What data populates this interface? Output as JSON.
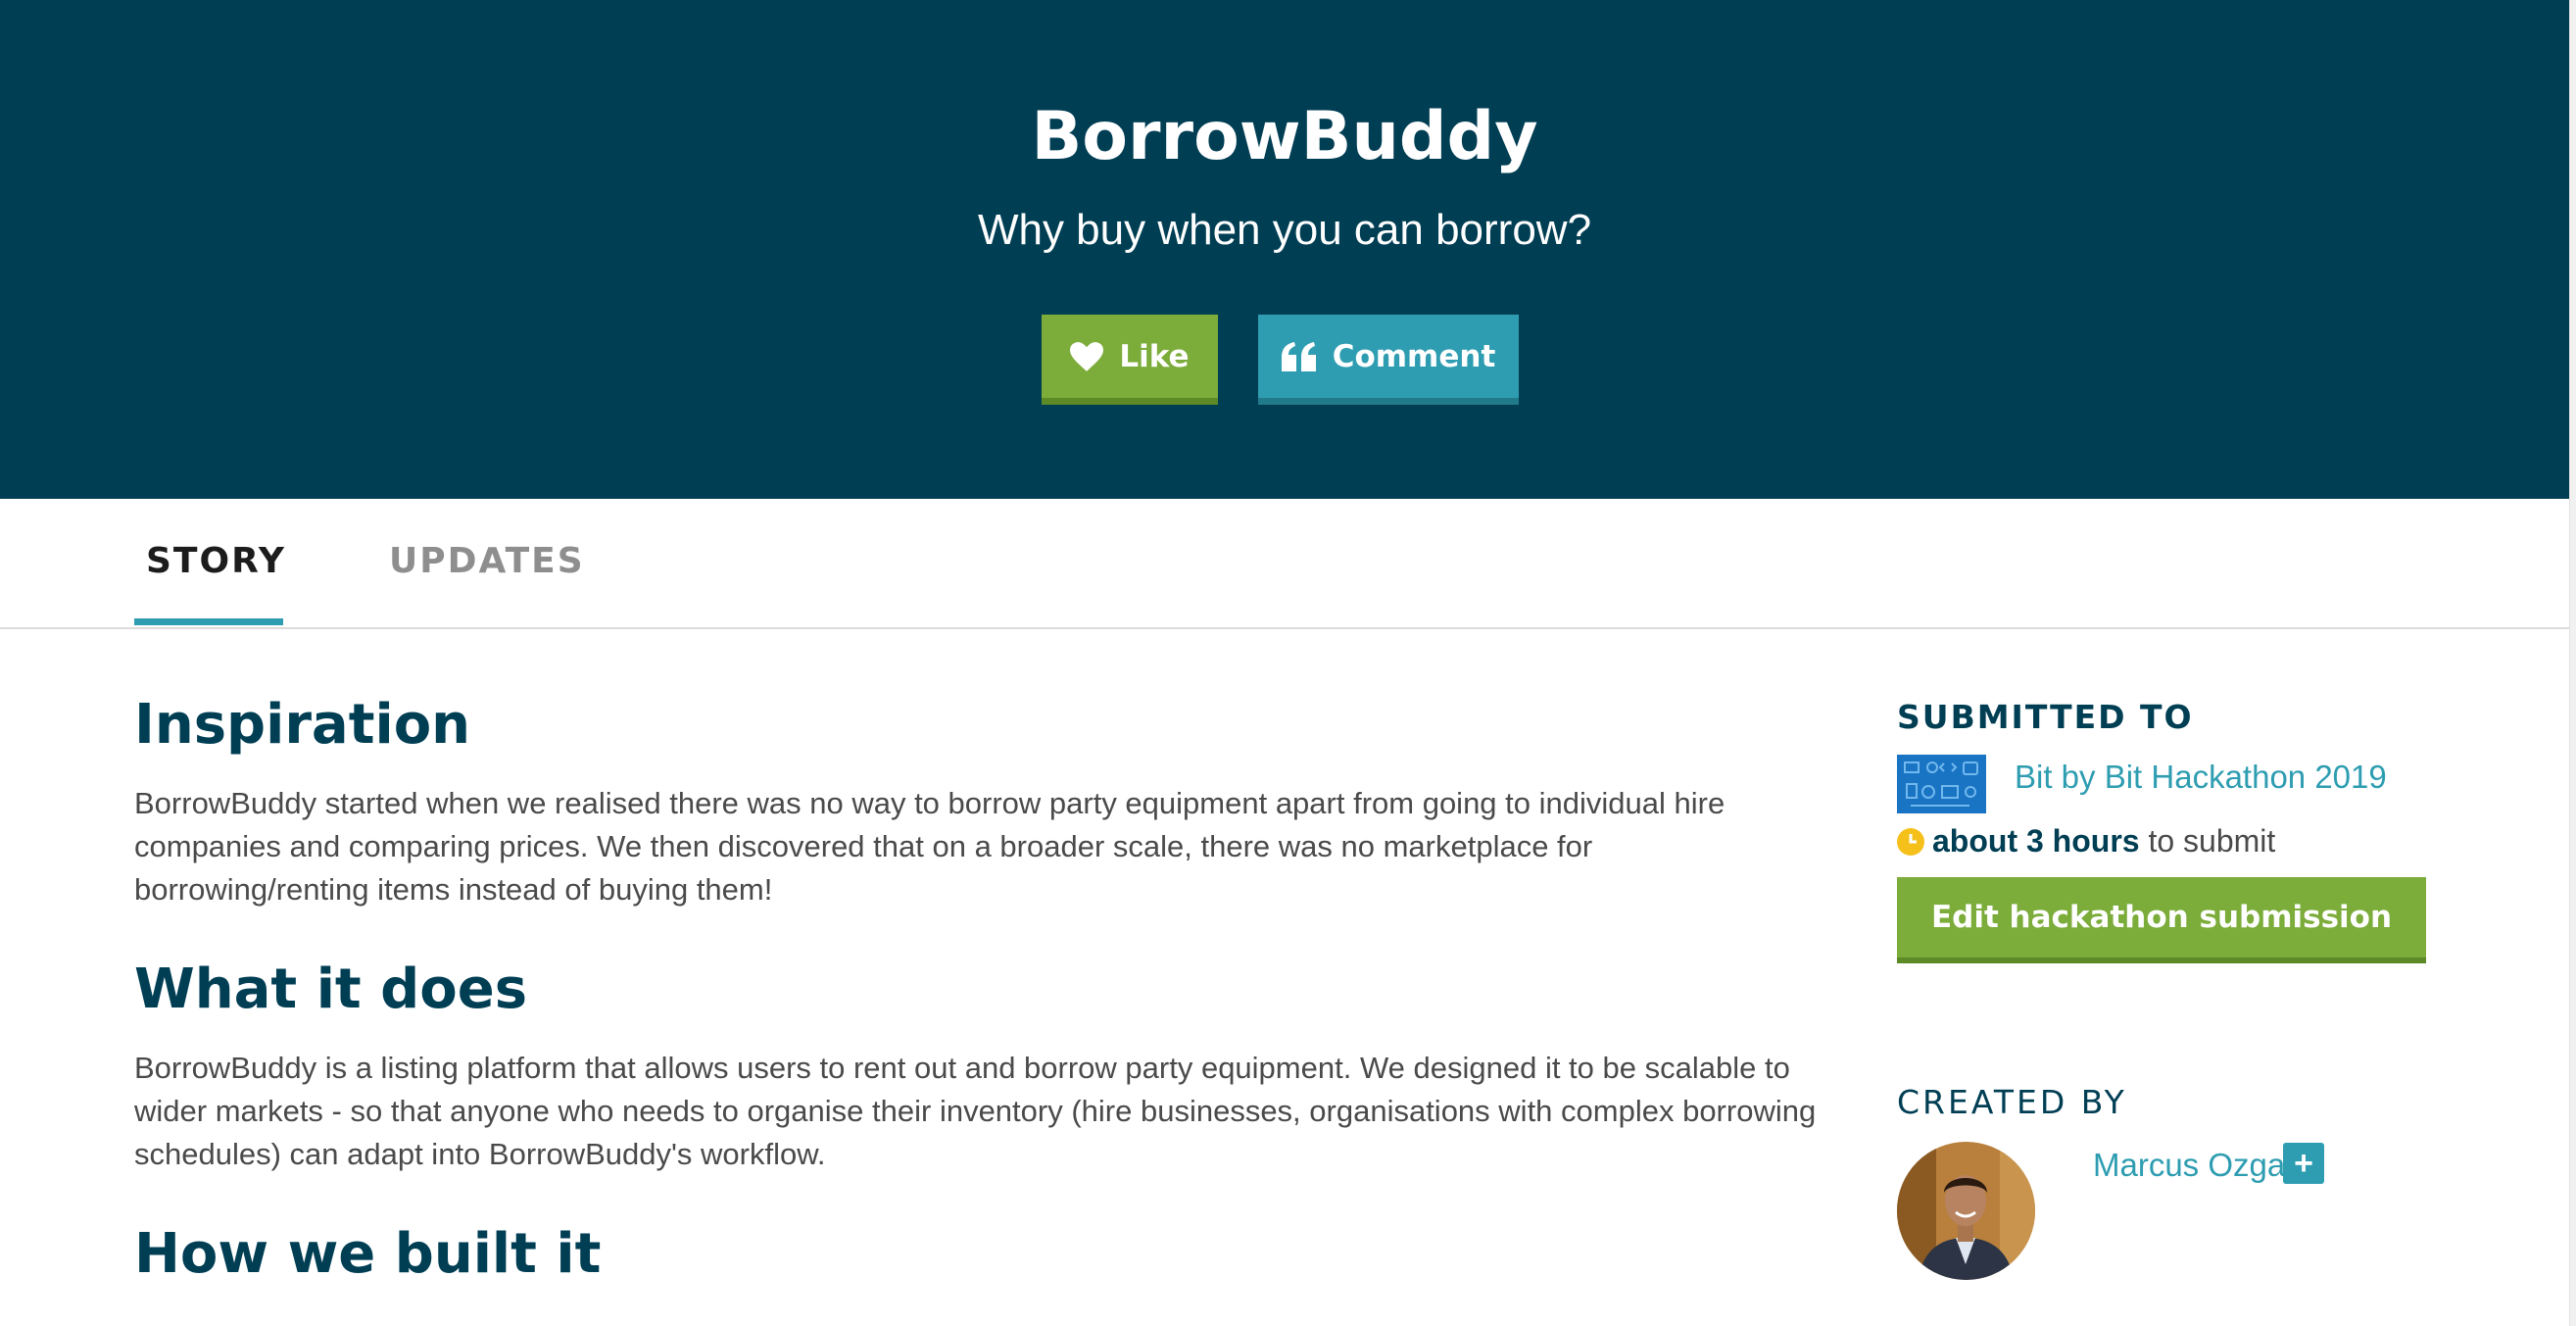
{
  "header": {
    "title": "BorrowBuddy",
    "tagline": "Why buy when you can borrow?",
    "like_label": "Like",
    "comment_label": "Comment"
  },
  "tabs": [
    {
      "label": "STORY",
      "active": true
    },
    {
      "label": "UPDATES",
      "active": false
    }
  ],
  "story": [
    {
      "heading": "Inspiration",
      "text": "BorrowBuddy started when we realised there was no way to borrow party equipment apart from going to individual hire companies and comparing prices. We then discovered that on a broader scale, there was no marketplace for borrowing/renting items instead of buying them!"
    },
    {
      "heading": "What it does",
      "text": "BorrowBuddy is a listing platform that allows users to rent out and borrow party equipment. We designed it to be scalable to wider markets - so that anyone who needs to organise their inventory (hire businesses, organisations with complex borrowing schedules) can adapt into BorrowBuddy's workflow."
    },
    {
      "heading": "How we built it"
    }
  ],
  "sidebar": {
    "submitted_heading": "SUBMITTED TO",
    "hackathon_name": "Bit by Bit Hackathon 2019",
    "deadline_bold": "about 3 hours",
    "deadline_rest": " to submit",
    "edit_button": "Edit hackathon submission",
    "created_heading": "CREATED BY",
    "creator_name": "Marcus Ozga",
    "follow_symbol": "+"
  },
  "colors": {
    "hero_bg": "#003e54",
    "like_green": "#7cac3a",
    "comment_teal": "#2e9db1",
    "heading_navy": "#003e54",
    "clock_yellow": "#f5c01a"
  },
  "icons": [
    "heart-icon",
    "quote-icon",
    "clock-icon",
    "plus-icon"
  ]
}
